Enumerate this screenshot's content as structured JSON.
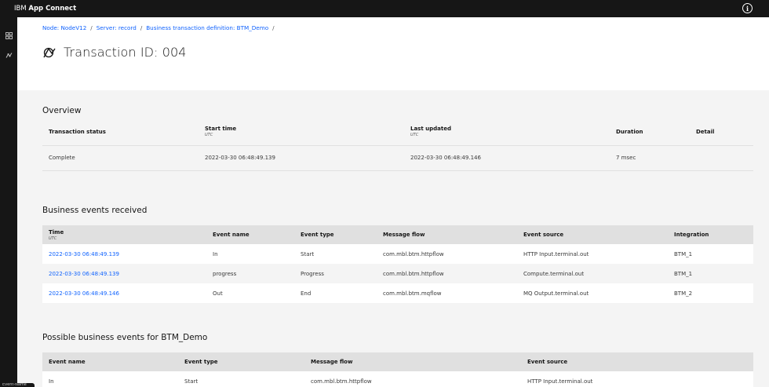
{
  "app": {
    "brand_prefix": "IBM",
    "brand_name": "App Connect"
  },
  "breadcrumb": [
    {
      "label": "Node: NodeV12"
    },
    {
      "label": "Server: record"
    },
    {
      "label": "Business transaction definition: BTM_Demo"
    }
  ],
  "breadcrumb_separator": "/",
  "page_title": "Transaction ID: 004",
  "overview": {
    "title": "Overview",
    "columns": [
      {
        "label": "Transaction status",
        "sub": ""
      },
      {
        "label": "Start time",
        "sub": "UTC"
      },
      {
        "label": "Last updated",
        "sub": "UTC"
      },
      {
        "label": "Duration",
        "sub": ""
      },
      {
        "label": "Detail",
        "sub": ""
      }
    ],
    "row": [
      "Complete",
      "2022-03-30 06:48:49.139",
      "2022-03-30 06:48:49.146",
      "7 msec",
      ""
    ]
  },
  "events": {
    "title": "Business events received",
    "columns": [
      {
        "label": "Time",
        "sub": "UTC"
      },
      {
        "label": "Event name",
        "sub": ""
      },
      {
        "label": "Event type",
        "sub": ""
      },
      {
        "label": "Message flow",
        "sub": ""
      },
      {
        "label": "Event source",
        "sub": ""
      },
      {
        "label": "Integration",
        "sub": ""
      }
    ],
    "rows": [
      [
        "2022-03-30 06:48:49.139",
        "In",
        "Start",
        "com.mbl.btm.httpflow",
        "HTTP Input.terminal.out",
        "BTM_1"
      ],
      [
        "2022-03-30 06:48:49.139",
        "progress",
        "Progress",
        "com.mbl.btm.httpflow",
        "Compute.terminal.out",
        "BTM_1"
      ],
      [
        "2022-03-30 06:48:49.146",
        "Out",
        "End",
        "com.mbl.btm.mqflow",
        "MQ Output.terminal.out",
        "BTM_2"
      ]
    ]
  },
  "possible": {
    "title": "Possible business events for BTM_Demo",
    "columns": [
      {
        "label": "Event name"
      },
      {
        "label": "Event type"
      },
      {
        "label": "Message flow"
      },
      {
        "label": "Event source"
      }
    ],
    "rows": [
      [
        "In",
        "Start",
        "com.mbl.btm.httpflow",
        "HTTP Input.terminal.out"
      ]
    ]
  },
  "footer_chip": "Event-Name",
  "icons": {
    "info": "info-icon",
    "nav_one": "dashboard-icon",
    "nav_two": "business-transaction-icon",
    "title": "transaction-flow-icon"
  },
  "colors": {
    "link": "#0f62fe",
    "shell": "#161616",
    "background": "#f4f4f4",
    "header_row": "#e0e0e0"
  }
}
